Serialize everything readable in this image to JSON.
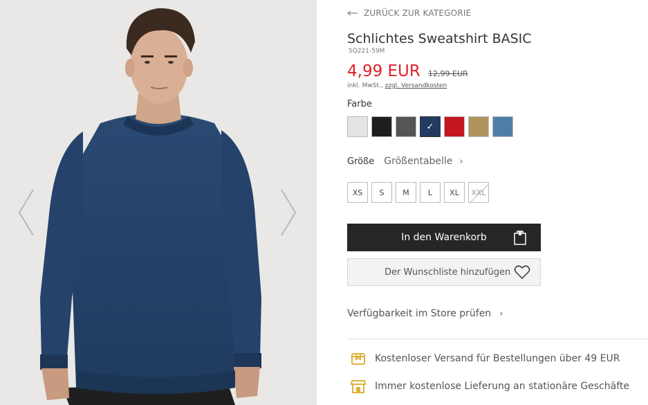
{
  "gallery": {
    "prev_icon": "chevron-left-icon",
    "next_icon": "chevron-right-icon"
  },
  "product": {
    "back_label": "ZURÜCK ZUR KATEGORIE",
    "title": "Schlichtes Sweatshirt BASIC",
    "sku": "SQ221-59M",
    "price": "4,99 EUR",
    "old_price": "12,99 EUR",
    "vat_prefix": "inkl. MwSt.,",
    "shipping_link": "zzgl. Versandkosten"
  },
  "colors": {
    "label": "Farbe",
    "selected_index": 3,
    "swatches": [
      {
        "name": "grau-meliert",
        "hex": "#e4e4e4"
      },
      {
        "name": "schwarz",
        "hex": "#1e1e1e"
      },
      {
        "name": "dunkelgrau",
        "hex": "#555555"
      },
      {
        "name": "marine",
        "hex": "#233a62"
      },
      {
        "name": "rot",
        "hex": "#c4161f"
      },
      {
        "name": "beige",
        "hex": "#b0945e"
      },
      {
        "name": "jeansblau",
        "hex": "#4f7fa6"
      }
    ]
  },
  "size": {
    "label": "Größe",
    "chart_link": "Größentabelle",
    "options": [
      {
        "label": "XS",
        "available": true
      },
      {
        "label": "S",
        "available": true
      },
      {
        "label": "M",
        "available": true
      },
      {
        "label": "L",
        "available": true
      },
      {
        "label": "XL",
        "available": true
      },
      {
        "label": "XXL",
        "available": false
      }
    ]
  },
  "actions": {
    "add_to_cart": "In den Warenkorb",
    "wishlist": "Der Wunschliste hinzufügen",
    "store_check": "Verfügbarkeit im Store prüfen"
  },
  "benefits": {
    "shipping": "Kostenloser Versand für Bestellungen über 49 EUR",
    "store_delivery": "Immer kostenlose Lieferung an stationäre Geschäfte"
  },
  "theme": {
    "price_red": "#e2202a",
    "button_dark": "#262626",
    "icon_gold": "#e1b13c"
  }
}
